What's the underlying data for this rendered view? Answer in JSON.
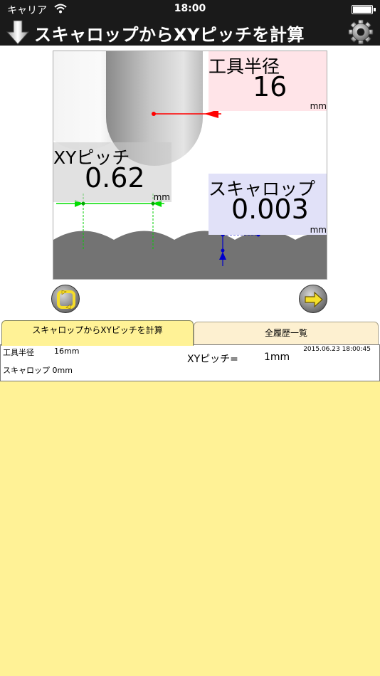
{
  "status_bar": {
    "carrier": "キャリア",
    "time": "18:00"
  },
  "nav": {
    "title": "スキャロップからXYピッチを計算",
    "left_icon": "download-arrow-icon",
    "right_icon": "gear-icon"
  },
  "diagram": {
    "tool_radius": {
      "label": "工具半径",
      "value": "16",
      "unit": "mm",
      "color": "#ffe4e8"
    },
    "xy_pitch": {
      "label": "XYピッチ",
      "value": "0.62",
      "unit": "mm"
    },
    "scallop": {
      "label": "スキャロップ",
      "value": "0.003",
      "unit": "mm",
      "color": "#e1e1f8"
    },
    "colors": {
      "radius_arrow": "#ff0000",
      "pitch_arrow": "#00dd00",
      "scallop_arrow": "#0000cc",
      "material": "#737373"
    }
  },
  "buttons": {
    "left_icon": "refresh-icon",
    "right_icon": "arrow-right-icon"
  },
  "tabs": [
    {
      "label": "スキャロップからXYピッチを計算",
      "active": true
    },
    {
      "label": "全履歴一覧",
      "active": false
    }
  ],
  "history": {
    "background": "#fff296",
    "record": {
      "radius_label": "工具半径",
      "radius_value": "16mm",
      "scallop_label": "スキャロップ",
      "scallop_value": "0mm",
      "xy_label": "XYピッチ=",
      "xy_value": "1mm",
      "timestamp": "2015.06.23 18:00:45"
    }
  }
}
